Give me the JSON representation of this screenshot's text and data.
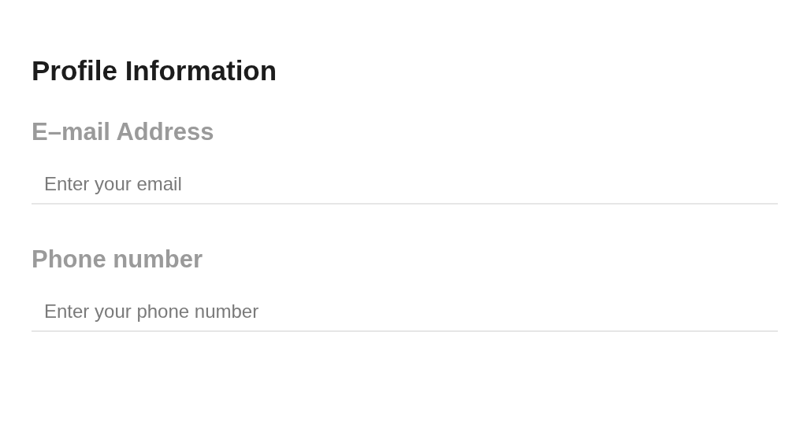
{
  "title": "Profile Information",
  "fields": [
    {
      "label": "E–mail Address",
      "placeholder": "Enter your email"
    },
    {
      "label": "Phone number",
      "placeholder": "Enter your phone number"
    }
  ]
}
